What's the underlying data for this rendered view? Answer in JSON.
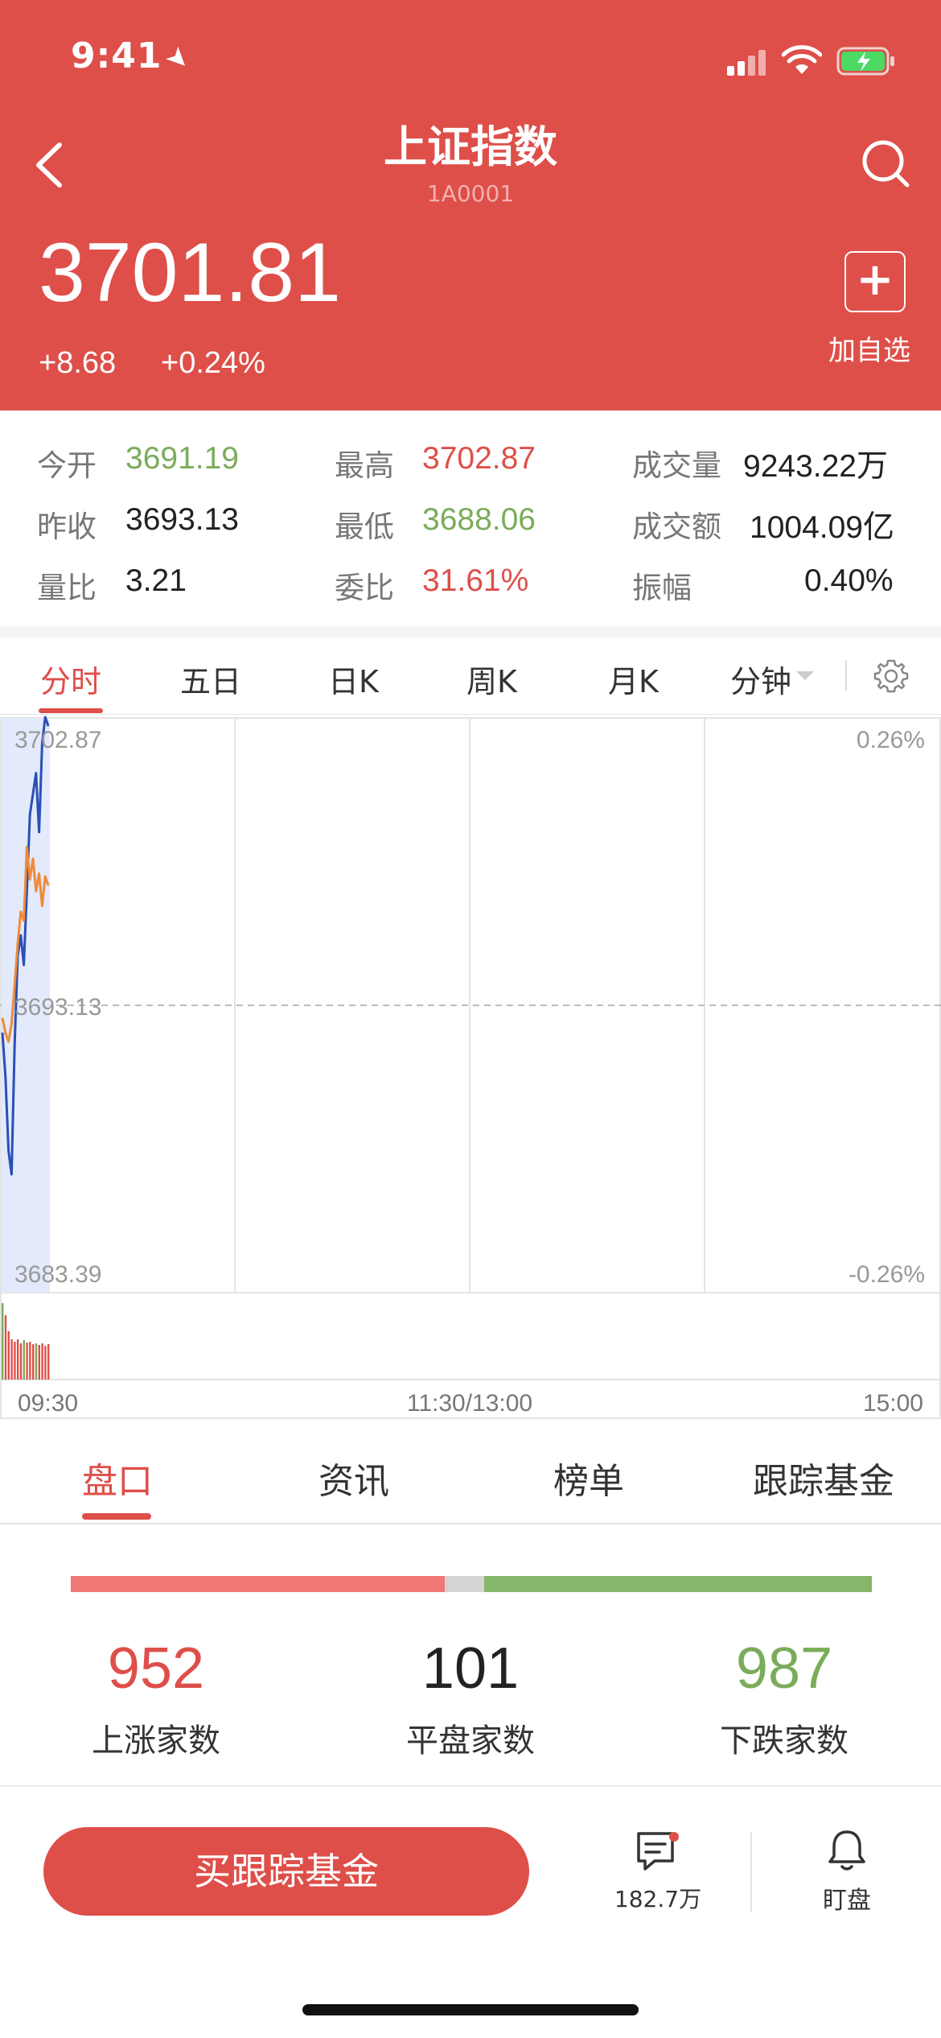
{
  "status_bar": {
    "time": "9:41"
  },
  "header": {
    "title": "上证指数",
    "code": "1A0001",
    "price": "3701.81",
    "change": "+8.68",
    "change_pct": "+0.24%",
    "add_label": "加自选"
  },
  "stats": [
    {
      "label": "今开",
      "value": "3691.19",
      "color": "#7aac5a"
    },
    {
      "label": "最高",
      "value": "3702.87",
      "color": "#de4f4a"
    },
    {
      "label": "成交量",
      "value": "9243.22万",
      "color": "#222222"
    },
    {
      "label": "昨收",
      "value": "3693.13",
      "color": "#222222"
    },
    {
      "label": "最低",
      "value": "3688.06",
      "color": "#7aac5a"
    },
    {
      "label": "成交额",
      "value": "1004.09亿",
      "color": "#222222"
    },
    {
      "label": "量比",
      "value": "3.21",
      "color": "#222222"
    },
    {
      "label": "委比",
      "value": "31.61%",
      "color": "#de4f4a"
    },
    {
      "label": "振幅",
      "value": "0.40%",
      "color": "#222222"
    }
  ],
  "chart_tabs": [
    "分时",
    "五日",
    "日K",
    "周K",
    "月K",
    "分钟"
  ],
  "chart_data": {
    "type": "line",
    "y_left_labels": [
      "3702.87",
      "3693.13",
      "3683.39"
    ],
    "y_right_labels": [
      "0.26%",
      "-0.26%"
    ],
    "x_labels": [
      "09:30",
      "11:30/13:00",
      "15:00"
    ],
    "ylim": [
      3683.39,
      3702.87
    ],
    "baseline": 3693.13,
    "series": [
      {
        "color": "#2a4fb5",
        "values": [
          3692.2,
          3690.7,
          3688.2,
          3687.4,
          3691.8,
          3694.8,
          3695.5,
          3694.5,
          3697.0,
          3699.6,
          3700.3,
          3701.0,
          3699.0,
          3702.0,
          3702.9,
          3702.6
        ]
      },
      {
        "color": "#f08a3a",
        "values": [
          3692.7,
          3692.2,
          3691.9,
          3692.5,
          3693.8,
          3695.2,
          3696.3,
          3696.0,
          3698.5,
          3697.4,
          3698.1,
          3697.0,
          3697.6,
          3696.5,
          3697.5,
          3697.2
        ]
      }
    ],
    "volume": [
      0.95,
      0.8,
      0.6,
      0.5,
      0.47,
      0.5,
      0.45,
      0.49,
      0.46,
      0.47,
      0.44,
      0.45,
      0.43,
      0.45,
      0.42,
      0.44
    ],
    "volume_colors": [
      "#7aac5a",
      "#de4f4a",
      "#de4f4a",
      "#de4f4a",
      "#de4f4a",
      "#de4f4a",
      "#de4f4a",
      "#7aac5a",
      "#de4f4a",
      "#de4f4a",
      "#de4f4a",
      "#7aac5a",
      "#de4f4a",
      "#de4f4a",
      "#de4f4a",
      "#de4f4a"
    ]
  },
  "bottom_tabs": [
    "盘口",
    "资讯",
    "榜单",
    "跟踪基金"
  ],
  "breadth": {
    "up": {
      "count": "952",
      "label": "上涨家数"
    },
    "flat": {
      "count": "101",
      "label": "平盘家数"
    },
    "down": {
      "count": "987",
      "label": "下跌家数"
    }
  },
  "actions": {
    "buy_label": "买跟踪基金",
    "comment_count": "182.7万",
    "watch_label": "盯盘"
  }
}
